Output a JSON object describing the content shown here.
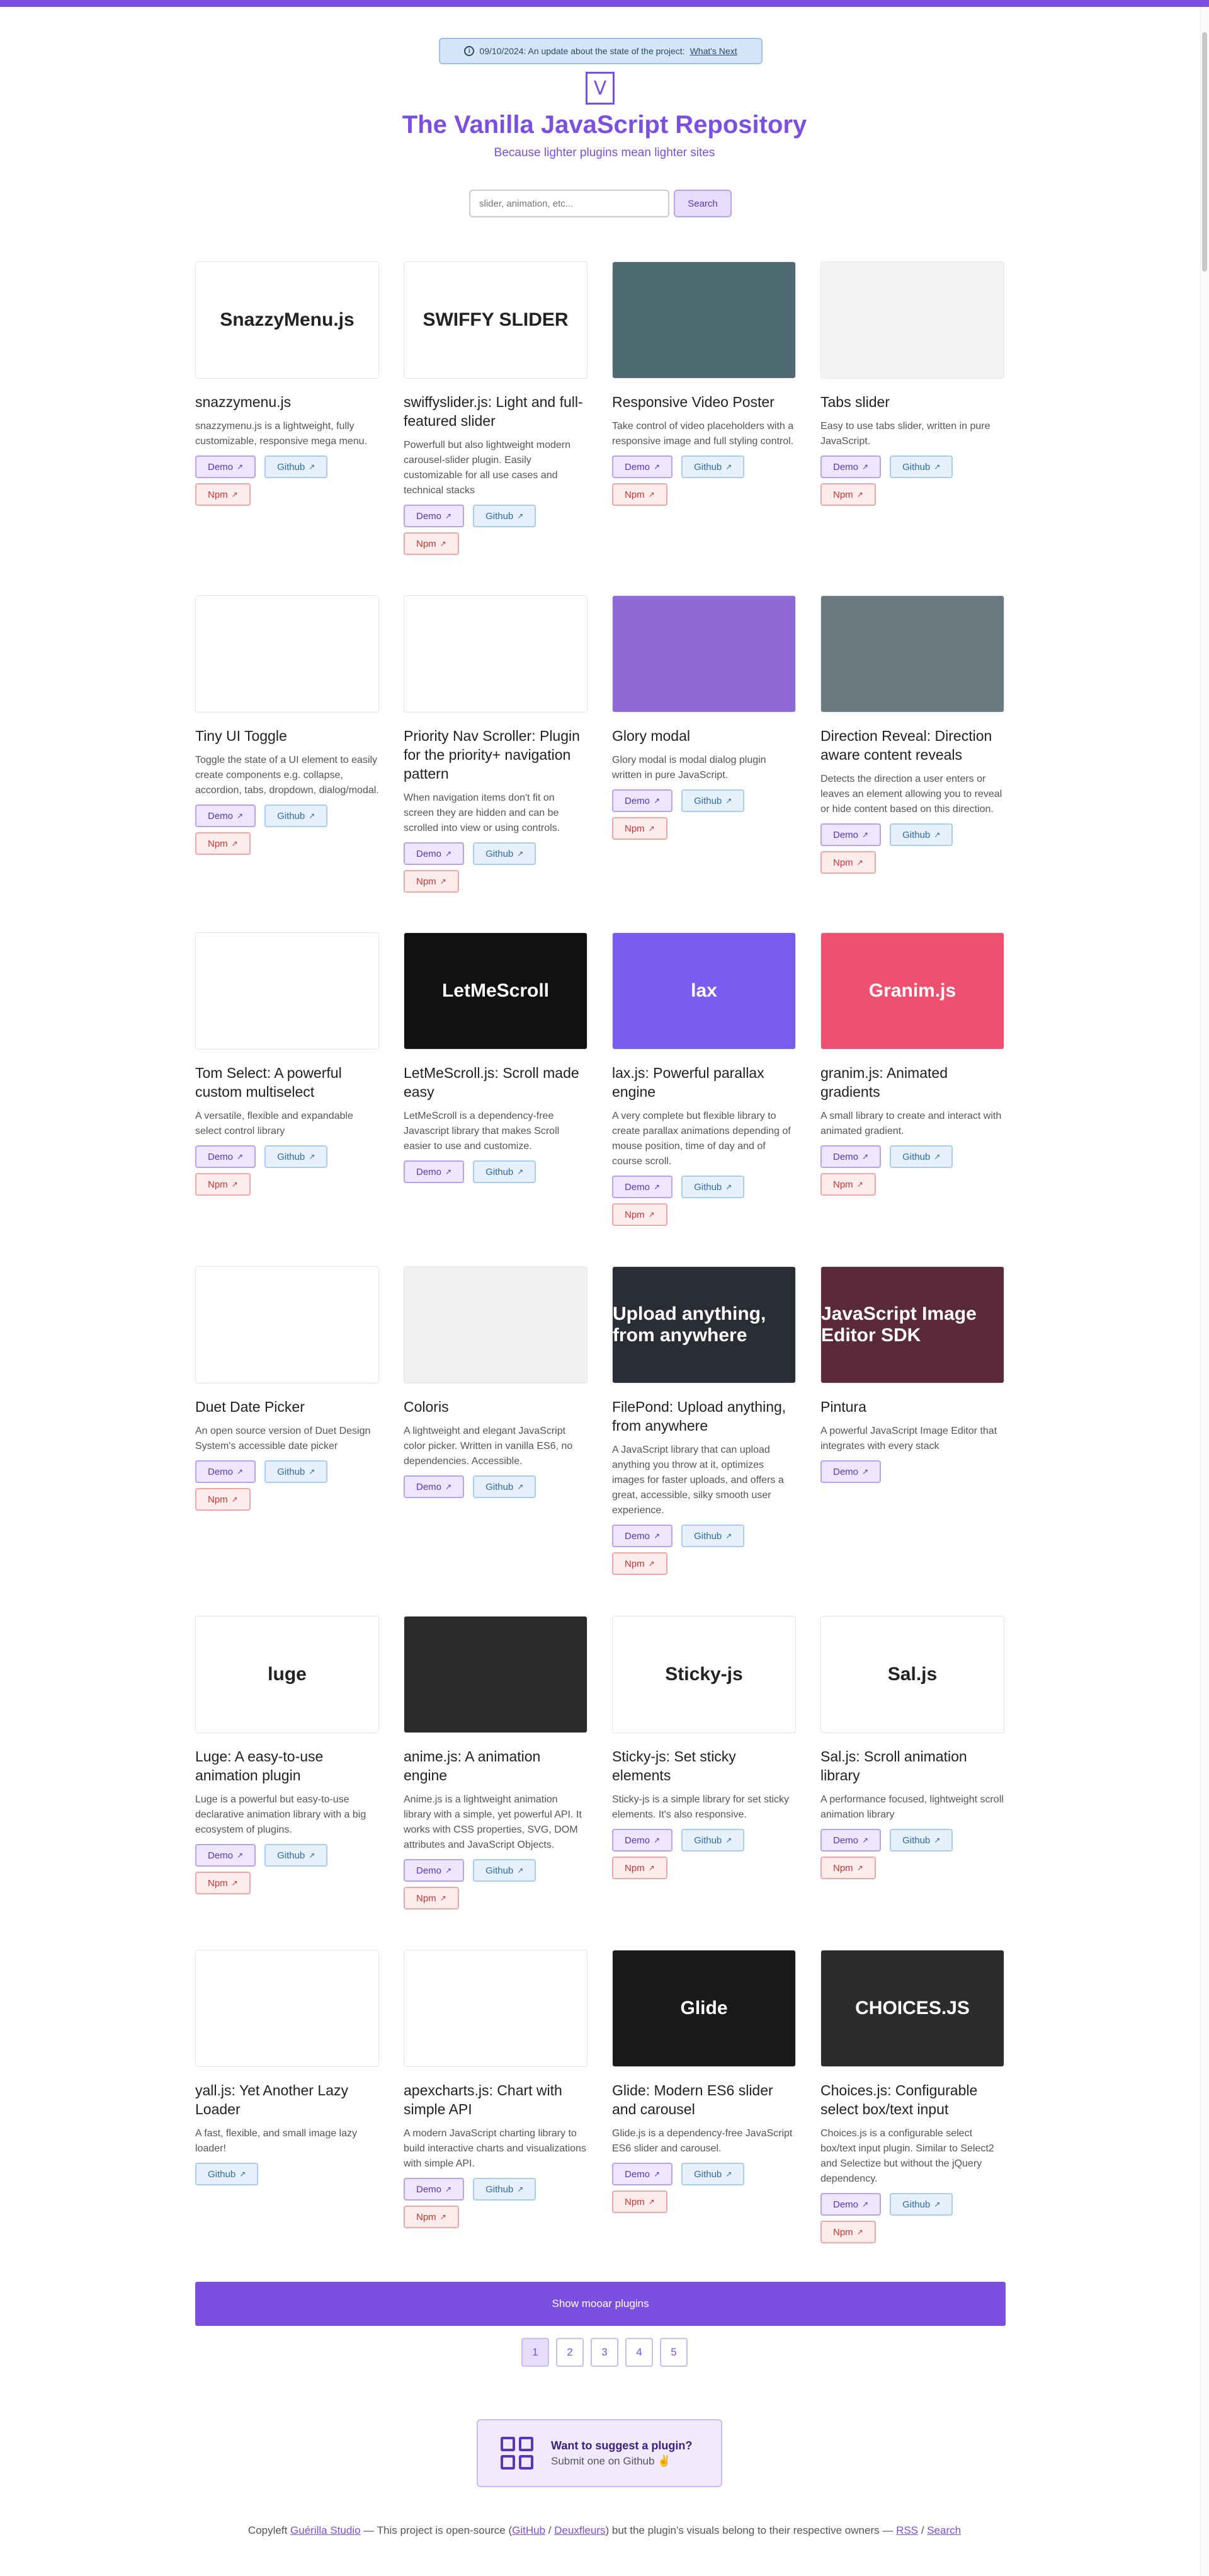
{
  "notice": {
    "text": "09/10/2024: An update about the state of the project:",
    "link": "What's Next"
  },
  "logo": "V",
  "title": "The Vanilla JavaScript Repository",
  "subtitle": "Because lighter plugins mean lighter sites",
  "search": {
    "placeholder": "slider, animation, etc...",
    "button": "Search"
  },
  "labels": {
    "demo": "Demo",
    "github": "Github",
    "npm": "Npm"
  },
  "plugins": [
    {
      "name": "snazzymenu.js",
      "desc": "snazzymenu.js is a lightweight, fully customizable, responsive mega menu.",
      "thumb": "SnazzyMenu.js",
      "links": [
        "demo",
        "github",
        "npm"
      ],
      "bg": "#ffffff"
    },
    {
      "name": "swiffyslider.js: Light and full-featured slider",
      "desc": "Powerfull but also lightweight modern carousel-slider plugin. Easily customizable for all use cases and technical stacks",
      "thumb": "SWIFFY SLIDER",
      "links": [
        "demo",
        "github",
        "npm"
      ],
      "bg": "#ffffff"
    },
    {
      "name": "Responsive Video Poster",
      "desc": "Take control of video placeholders with a responsive image and full styling control.",
      "thumb": "",
      "links": [
        "demo",
        "github",
        "npm"
      ],
      "bg": "#4e6a73"
    },
    {
      "name": "Tabs slider",
      "desc": "Easy to use tabs slider, written in pure JavaScript.",
      "thumb": "",
      "links": [
        "demo",
        "github",
        "npm"
      ],
      "bg": "#f3f3f3"
    },
    {
      "name": "Tiny UI Toggle",
      "desc": "Toggle the state of a UI element to easily create components e.g. collapse, accordion, tabs, dropdown, dialog/modal.",
      "thumb": "",
      "links": [
        "demo",
        "github",
        "npm"
      ],
      "bg": "#ffffff"
    },
    {
      "name": "Priority Nav Scroller: Plugin for the priority+ navigation pattern",
      "desc": "When navigation items don't fit on screen they are hidden and can be scrolled into view or using controls.",
      "thumb": "",
      "links": [
        "demo",
        "github",
        "npm"
      ],
      "bg": "#ffffff"
    },
    {
      "name": "Glory modal",
      "desc": "Glory modal is modal dialog plugin written in pure JavaScript.",
      "thumb": "",
      "links": [
        "demo",
        "github",
        "npm"
      ],
      "bg": "#8f6ad6"
    },
    {
      "name": "Direction Reveal: Direction aware content reveals",
      "desc": "Detects the direction a user enters or leaves an element allowing you to reveal or hide content based on this direction.",
      "thumb": "",
      "links": [
        "demo",
        "github",
        "npm"
      ],
      "bg": "#6b7a80"
    },
    {
      "name": "Tom Select: A powerful custom multiselect",
      "desc": "A versatile, flexible and expandable select control library",
      "thumb": "",
      "links": [
        "demo",
        "github",
        "npm"
      ],
      "bg": "#ffffff"
    },
    {
      "name": "LetMeScroll.js: Scroll made easy",
      "desc": "LetMeScroll is a dependency-free Javascript library that makes Scroll easier to use and customize.",
      "thumb": "LetMeScroll",
      "links": [
        "demo",
        "github"
      ],
      "bg": "#111111"
    },
    {
      "name": "lax.js: Powerful parallax engine",
      "desc": "A very complete but flexible library to create parallax animations depending of mouse position, time of day and of course scroll.",
      "thumb": "lax",
      "links": [
        "demo",
        "github",
        "npm"
      ],
      "bg": "#7b5cf0"
    },
    {
      "name": "granim.js: Animated gradients",
      "desc": "A small library to create and interact with animated gradient.",
      "thumb": "Granim.js",
      "links": [
        "demo",
        "github",
        "npm"
      ],
      "bg": "#ef5070"
    },
    {
      "name": "Duet Date Picker",
      "desc": "An open source version of Duet Design System's accessible date picker",
      "thumb": "",
      "links": [
        "demo",
        "github",
        "npm"
      ],
      "bg": "#ffffff"
    },
    {
      "name": "Coloris",
      "desc": "A lightweight and elegant JavaScript color picker. Written in vanilla ES6, no dependencies. Accessible.",
      "thumb": "",
      "links": [
        "demo",
        "github"
      ],
      "bg": "#f1f1f1"
    },
    {
      "name": "FilePond: Upload anything, from anywhere",
      "desc": "A JavaScript library that can upload anything you throw at it, optimizes images for faster uploads, and offers a great, accessible, silky smooth user experience.",
      "thumb": "Upload anything, from anywhere",
      "links": [
        "demo",
        "github",
        "npm"
      ],
      "bg": "#2b2d35"
    },
    {
      "name": "Pintura",
      "desc": "A powerful JavaScript Image Editor that integrates with every stack",
      "thumb": "JavaScript Image Editor SDK",
      "links": [
        "demo"
      ],
      "bg": "#5a2a3a"
    },
    {
      "name": "Luge: A easy-to-use animation plugin",
      "desc": "Luge is a powerful but easy-to-use declarative animation library with a big ecosystem of plugins.",
      "thumb": "luge",
      "links": [
        "demo",
        "github",
        "npm"
      ],
      "bg": "#ffffff"
    },
    {
      "name": "anime.js: A animation engine",
      "desc": "Anime.js is a lightweight animation library with a simple, yet powerful API. It works with CSS properties, SVG, DOM attributes and JavaScript Objects.",
      "thumb": "",
      "links": [
        "demo",
        "github",
        "npm"
      ],
      "bg": "#2a2a2a"
    },
    {
      "name": "Sticky-js: Set sticky elements",
      "desc": "Sticky-js is a simple library for set sticky elements. It's also responsive.",
      "thumb": "Sticky-js",
      "links": [
        "demo",
        "github",
        "npm"
      ],
      "bg": "#ffffff"
    },
    {
      "name": "Sal.js: Scroll animation library",
      "desc": "A performance focused, lightweight scroll animation library",
      "thumb": "Sal.js",
      "links": [
        "demo",
        "github",
        "npm"
      ],
      "bg": "#ffffff"
    },
    {
      "name": "yall.js: Yet Another Lazy Loader",
      "desc": "A fast, flexible, and small image lazy loader!",
      "thumb": "",
      "links": [
        "github"
      ],
      "bg": "#ffffff"
    },
    {
      "name": "apexcharts.js: Chart with simple API",
      "desc": "A modern JavaScript charting library to build interactive charts and visualizations with simple API.",
      "thumb": "",
      "links": [
        "demo",
        "github",
        "npm"
      ],
      "bg": "#ffffff"
    },
    {
      "name": "Glide: Modern ES6 slider and carousel",
      "desc": "Glide.js is a dependency-free JavaScript ES6 slider and carousel.",
      "thumb": "Glide",
      "links": [
        "demo",
        "github",
        "npm"
      ],
      "bg": "#1a1a1a"
    },
    {
      "name": "Choices.js: Configurable select box/text input",
      "desc": "Choices.js is a configurable select box/text input plugin. Similar to Select2 and Selectize but without the jQuery dependency.",
      "thumb": "CHOICES.JS",
      "links": [
        "demo",
        "github",
        "npm"
      ],
      "bg": "#2c2c2c"
    }
  ],
  "more_button": "Show mooar plugins",
  "pages": [
    "1",
    "2",
    "3",
    "4",
    "5"
  ],
  "suggest": {
    "title": "Want to suggest a plugin?",
    "sub": "Submit one on Github ✌️"
  },
  "footer": {
    "pre": "Copyleft ",
    "studio": "Guérilla Studio",
    "mid": " — This project is open-source (",
    "github": "GitHub",
    "sep": " / ",
    "deuxfleurs": "Deuxfleurs",
    "post": ") but the plugin's visuals belong to their respective owners — ",
    "rss": "RSS",
    "slash": " / ",
    "search": "Search"
  },
  "colors": {
    "accent": "#7b4fe0"
  }
}
